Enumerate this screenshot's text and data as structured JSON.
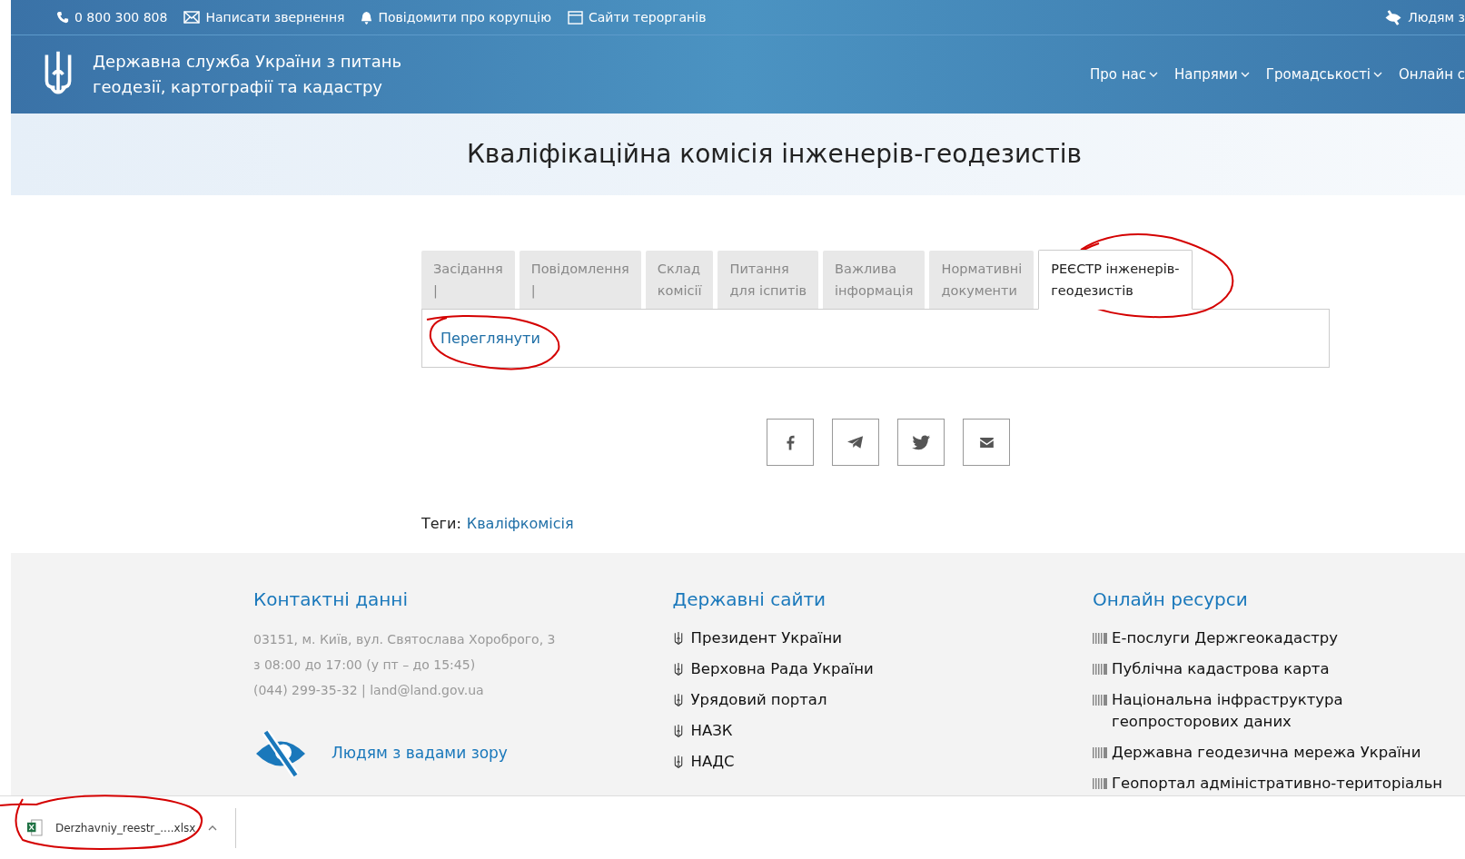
{
  "top_bar": {
    "items": [
      {
        "kind": "phone",
        "label": "0 800 300 808"
      },
      {
        "kind": "mail",
        "label": "Написати звернення"
      },
      {
        "kind": "bell",
        "label": "Повідомити про корупцію"
      },
      {
        "kind": "window",
        "label": "Сайти терорганів"
      }
    ],
    "accessibility": "Людям з"
  },
  "header": {
    "title_lines": [
      "Державна служба України з питань",
      "геодезії, картографії та кадастру"
    ],
    "nav": [
      {
        "label": "Про нас",
        "caret": true
      },
      {
        "label": "Напрями",
        "caret": true
      },
      {
        "label": "Громадськості",
        "caret": true
      },
      {
        "label": "Онлайн с",
        "caret": false
      }
    ]
  },
  "page_title": "Кваліфікаційна комісія інженерів-геодезистів",
  "tabs": [
    {
      "lines": [
        "Засідання",
        "|"
      ],
      "selected": false
    },
    {
      "lines": [
        "Повідомлення",
        "|"
      ],
      "selected": false
    },
    {
      "lines": [
        "Склад",
        "комісії"
      ],
      "selected": false
    },
    {
      "lines": [
        "Питання",
        "для іспитів"
      ],
      "selected": false
    },
    {
      "lines": [
        "Важлива",
        "інформація"
      ],
      "selected": false
    },
    {
      "lines": [
        "Нормативні",
        "документи"
      ],
      "selected": false
    },
    {
      "lines": [
        "РЕЄСТР інженерів-",
        "геодезистів"
      ],
      "selected": true
    }
  ],
  "tab_panel": {
    "link": "Переглянути"
  },
  "share": [
    {
      "kind": "facebook"
    },
    {
      "kind": "telegram"
    },
    {
      "kind": "twitter"
    },
    {
      "kind": "email"
    }
  ],
  "tags": {
    "label": "Теги:",
    "items": [
      "Кваліфкомісія"
    ]
  },
  "footer": {
    "contacts": {
      "title": "Контактні данні",
      "lines": [
        "03151, м. Київ, вул. Святослава Хороброго, 3",
        "з 08:00 до 17:00 (у пт – до 15:45)",
        "(044) 299-35-32 | land@land.gov.ua"
      ],
      "accessibility": "Людям з вадами зору"
    },
    "gov_sites": {
      "title": "Державні сайти",
      "items": [
        "Президент України",
        "Верховна Рада України",
        "Урядовий портал",
        "НАЗК",
        "НАДС"
      ]
    },
    "online": {
      "title": "Онлайн ресурси",
      "items": [
        "Е-послуги Держгеокадастру",
        "Публічна кадастрова карта",
        "Національна інфраструктура геопросторових даних",
        "Державна геодезична мережа України",
        "Геопортал адміністративно-територіальн"
      ]
    }
  },
  "download_bar": {
    "file": "Derzhavniy_reestr_....xlsx"
  }
}
